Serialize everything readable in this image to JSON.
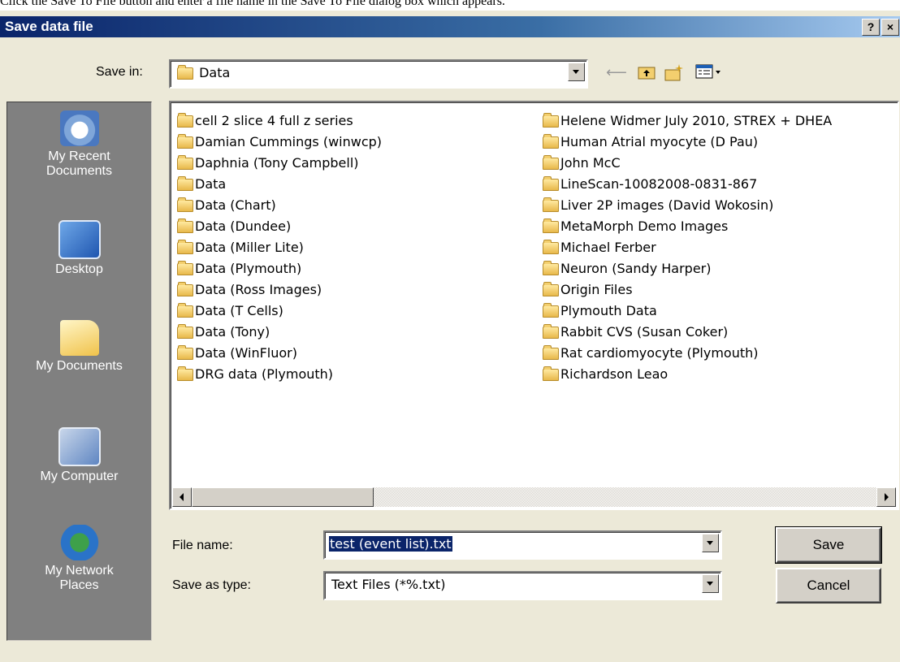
{
  "caption": "Click the Save To File button and enter a file name in the Save To File dialog box which appears.",
  "dialog": {
    "title": "Save data file",
    "help_button": "?",
    "close_button": "×"
  },
  "save_in": {
    "label": "Save in:",
    "value": "Data"
  },
  "toolbar": {
    "back_icon": "back-arrow-icon",
    "up_icon": "up-folder-icon",
    "new_folder_icon": "new-folder-icon",
    "views_icon": "views-menu-icon"
  },
  "places": [
    {
      "label_line1": "My Recent",
      "label_line2": "Documents",
      "icon": "recent-documents-icon"
    },
    {
      "label_line1": "Desktop",
      "label_line2": "",
      "icon": "desktop-icon"
    },
    {
      "label_line1": "My Documents",
      "label_line2": "",
      "icon": "my-documents-icon"
    },
    {
      "label_line1": "My Computer",
      "label_line2": "",
      "icon": "my-computer-icon"
    },
    {
      "label_line1": "My Network",
      "label_line2": "Places",
      "icon": "network-places-icon"
    }
  ],
  "files_left": [
    "cell 2 slice 4 full z series",
    "Damian Cummings (winwcp)",
    "Daphnia (Tony Campbell)",
    "Data",
    "Data (Chart)",
    "Data (Dundee)",
    "Data (Miller Lite)",
    "Data (Plymouth)",
    "Data (Ross Images)",
    "Data (T Cells)",
    "Data (Tony)",
    "Data (WinFluor)",
    "DRG data (Plymouth)"
  ],
  "files_right": [
    "Helene Widmer July 2010, STREX + DHEA",
    "Human Atrial myocyte (D Pau)",
    "John McC",
    "LineScan-10082008-0831-867",
    "Liver 2P images (David Wokosin)",
    "MetaMorph Demo Images",
    "Michael Ferber",
    "Neuron (Sandy Harper)",
    "Origin Files",
    "Plymouth Data",
    "Rabbit CVS (Susan Coker)",
    "Rat cardiomyocyte (Plymouth)",
    "Richardson Leao"
  ],
  "file_name": {
    "label": "File name:",
    "value": "test (event list).txt"
  },
  "save_as_type": {
    "label": "Save as type:",
    "value": "Text Files (*%.txt)"
  },
  "buttons": {
    "save": "Save",
    "cancel": "Cancel"
  },
  "colors": {
    "title_bar": "#0a246a",
    "selection": "#0a246a",
    "dialog_bg": "#ece9d8",
    "places_bg": "#808080"
  }
}
